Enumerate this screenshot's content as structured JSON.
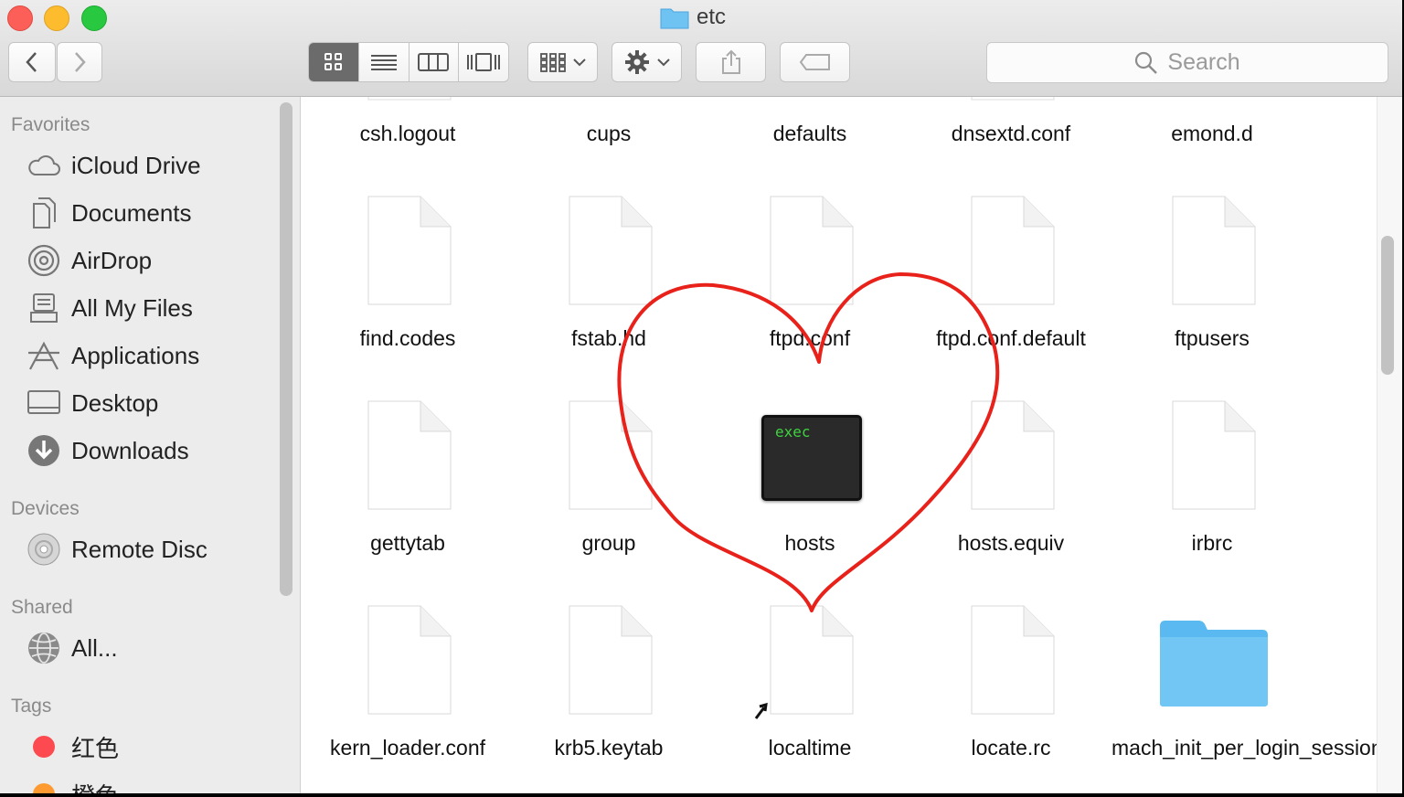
{
  "window": {
    "title": "etc"
  },
  "toolbar": {
    "search_placeholder": "Search"
  },
  "sidebar": {
    "sections": [
      {
        "header": "Favorites",
        "items": [
          {
            "label": "iCloud Drive",
            "icon": "cloud-icon"
          },
          {
            "label": "Documents",
            "icon": "documents-icon"
          },
          {
            "label": "AirDrop",
            "icon": "airdrop-icon"
          },
          {
            "label": "All My Files",
            "icon": "all-files-icon"
          },
          {
            "label": "Applications",
            "icon": "applications-icon"
          },
          {
            "label": "Desktop",
            "icon": "desktop-icon"
          },
          {
            "label": "Downloads",
            "icon": "downloads-icon"
          }
        ]
      },
      {
        "header": "Devices",
        "items": [
          {
            "label": "Remote Disc",
            "icon": "disc-icon"
          }
        ]
      },
      {
        "header": "Shared",
        "items": [
          {
            "label": "All...",
            "icon": "network-icon"
          }
        ]
      },
      {
        "header": "Tags",
        "items": [
          {
            "label": "红色",
            "icon": "red-tag-icon",
            "color": "#fc4a50"
          },
          {
            "label": "橙色",
            "icon": "orange-tag-icon",
            "color": "#fd9a32"
          }
        ]
      }
    ]
  },
  "files": {
    "row0": [
      "csh.logout",
      "cups",
      "defaults",
      "dnsextd.conf",
      "emond.d"
    ],
    "row1": [
      "find.codes",
      "fstab.hd",
      "ftpd.conf",
      "ftpd.conf.default",
      "ftpusers"
    ],
    "row2": [
      "gettytab",
      "group",
      "hosts",
      "hosts.equiv",
      "irbrc"
    ],
    "row3": [
      "kern_loader.conf",
      "krb5.keytab",
      "localtime",
      "locate.rc",
      "mach_init_per_login_session.d"
    ]
  },
  "exec_icon_label": "exec",
  "colors": {
    "annotation": "#e8221b",
    "folder": "#5ab9f0"
  }
}
